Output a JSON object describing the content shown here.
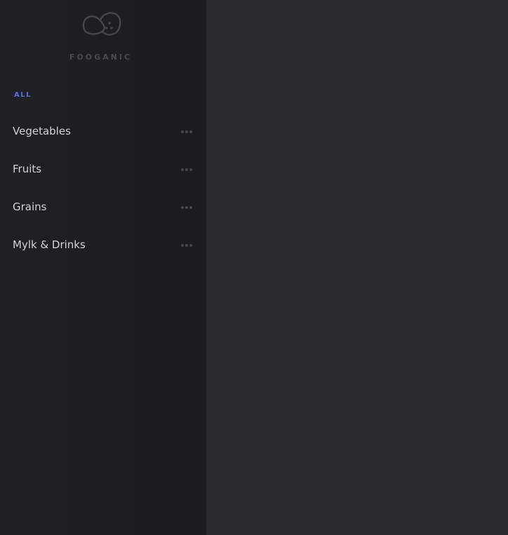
{
  "brand": {
    "name": "FOOGANIC",
    "logo_icon": "leaf-fruit-logo-icon"
  },
  "filter": {
    "all_label": "ALL",
    "accent_color": "#5a6ee0"
  },
  "categories": [
    {
      "label": "Vegetables",
      "menu_icon": "more-dots-icon"
    },
    {
      "label": "Fruits",
      "menu_icon": "more-dots-icon"
    },
    {
      "label": "Grains",
      "menu_icon": "more-dots-icon"
    },
    {
      "label": "Mylk & Drinks",
      "menu_icon": "more-dots-icon"
    }
  ],
  "colors": {
    "sidebar_bg": "#1d1e22",
    "main_bg": "#2a2b30",
    "text": "#d3d4d8",
    "muted": "#4a4b52"
  }
}
